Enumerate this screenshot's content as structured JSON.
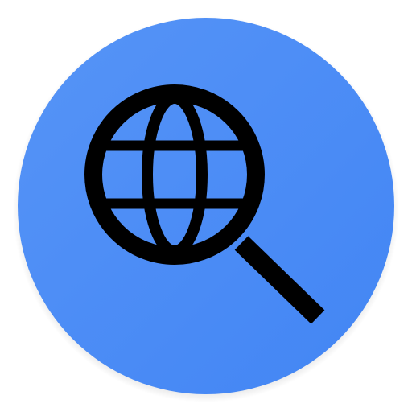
{
  "app_icon": {
    "icon_name": "globe-search-icon",
    "background_color": "#4285F4",
    "background_color_light": "#5694F7",
    "glyph_color": "#000000"
  }
}
